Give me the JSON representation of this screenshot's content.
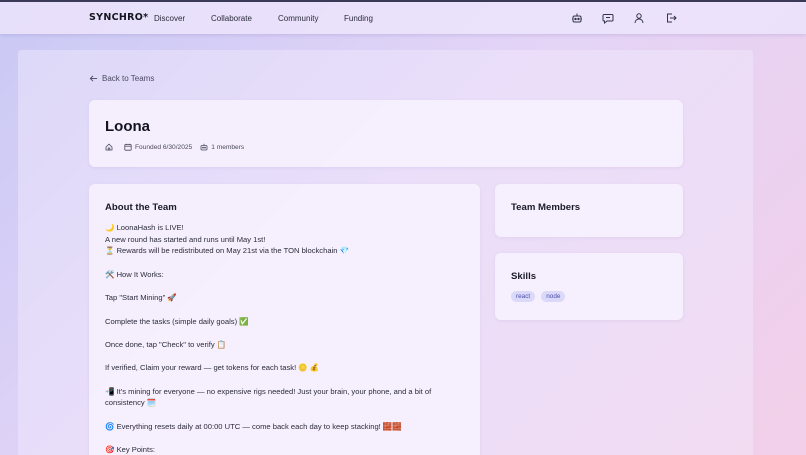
{
  "nav": {
    "logo": "SYNCHRO*",
    "links": [
      "Discover",
      "Collaborate",
      "Community",
      "Funding"
    ],
    "icons": [
      "bot-icon",
      "chat-icon",
      "user-icon",
      "logout-icon"
    ]
  },
  "back_link": "Back to Teams",
  "team": {
    "name": "Loona",
    "founded": "Founded 6/30/2025",
    "members": "1 members"
  },
  "about": {
    "title": "About the Team",
    "lines": [
      "🌙 LoonaHash is LIVE!",
      "A new round has started and runs until May 1st!",
      "⏳ Rewards will be redistributed on May 21st via the TON blockchain 💎",
      "",
      "🛠️ How It Works:",
      "",
      "Tap \"Start Mining\" 🚀",
      "",
      "Complete the tasks (simple daily goals) ✅",
      "",
      "Once done, tap \"Check\" to verify 📋",
      "",
      "If verified, Claim your reward — get tokens for each task! 🪙 💰",
      "",
      "📲 It's mining for everyone — no expensive rigs needed! Just your brain, your phone, and a bit of",
      "consistency 🗓️",
      "",
      "🌀 Everything resets daily at 00:00 UTC — come back each day to keep stacking! 🧱🧱",
      "",
      "🎯 Key Points:"
    ]
  },
  "members_title": "Team Members",
  "skills": {
    "title": "Skills",
    "tags": [
      "react",
      "node"
    ]
  }
}
